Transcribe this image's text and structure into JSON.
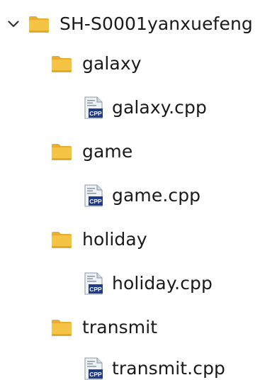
{
  "tree": {
    "root": {
      "label": "SH-S0001yanxuefeng",
      "expanded": true,
      "icon": "folder-icon"
    },
    "children": [
      {
        "folder": {
          "label": "galaxy",
          "icon": "folder-icon"
        },
        "file": {
          "label": "galaxy.cpp",
          "icon": "cpp-file-icon",
          "badge": "CPP"
        }
      },
      {
        "folder": {
          "label": "game",
          "icon": "folder-icon"
        },
        "file": {
          "label": "game.cpp",
          "icon": "cpp-file-icon",
          "badge": "CPP"
        }
      },
      {
        "folder": {
          "label": "holiday",
          "icon": "folder-icon"
        },
        "file": {
          "label": "holiday.cpp",
          "icon": "cpp-file-icon",
          "badge": "CPP"
        }
      },
      {
        "folder": {
          "label": "transmit",
          "icon": "folder-icon"
        },
        "file": {
          "label": "transmit.cpp",
          "icon": "cpp-file-icon",
          "badge": "CPP"
        }
      }
    ]
  },
  "colors": {
    "folder_body": "#f6c445",
    "folder_tab": "#e9ad2b",
    "folder_shadow": "#d99a1a",
    "cpp_badge": "#1e3a8a",
    "file_page": "#dfe6ee",
    "text": "#1a1a1a"
  }
}
